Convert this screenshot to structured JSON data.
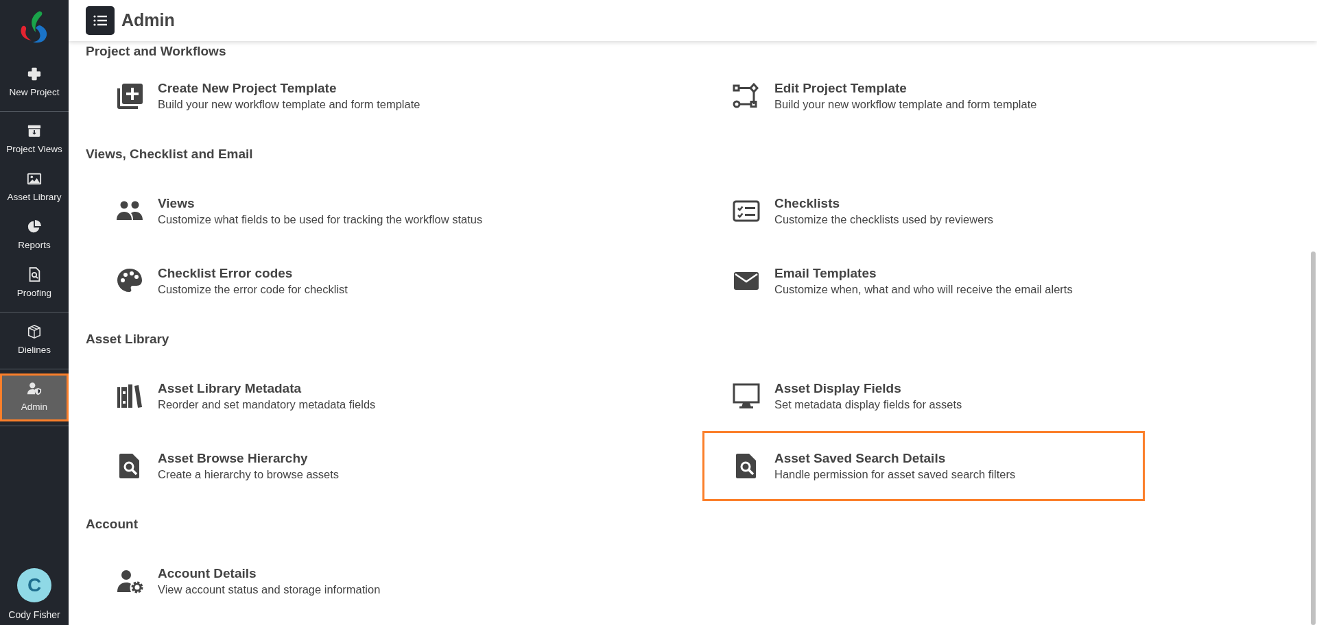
{
  "header": {
    "title": "Admin"
  },
  "sidebar": {
    "groups": [
      [
        {
          "label": "New Project",
          "selected": false
        }
      ],
      [
        {
          "label": "Project Views",
          "selected": false
        },
        {
          "label": "Asset Library",
          "selected": false
        },
        {
          "label": "Reports",
          "selected": false
        },
        {
          "label": "Proofing",
          "selected": false
        }
      ],
      [
        {
          "label": "Dielines",
          "selected": false
        }
      ],
      [
        {
          "label": "Admin",
          "selected": true
        }
      ]
    ],
    "user": {
      "initial": "C",
      "name": "Cody Fisher"
    }
  },
  "sections": [
    {
      "title": "Project and Workflows",
      "items": [
        {
          "title": "Create New Project Template",
          "description": "Build your new workflow template and form template",
          "highlighted": false
        },
        {
          "title": "Edit Project Template",
          "description": "Build your new workflow template and form template",
          "highlighted": false
        }
      ]
    },
    {
      "title": "Views, Checklist and Email",
      "items": [
        {
          "title": "Views",
          "description": "Customize what fields to be used for tracking the workflow status",
          "highlighted": false
        },
        {
          "title": "Checklists",
          "description": "Customize the checklists used by reviewers",
          "highlighted": false
        },
        {
          "title": "Checklist Error codes",
          "description": "Customize the error code for checklist",
          "highlighted": false
        },
        {
          "title": "Email Templates",
          "description": "Customize when, what and who will receive the email alerts",
          "highlighted": false
        }
      ]
    },
    {
      "title": "Asset Library",
      "items": [
        {
          "title": "Asset Library Metadata",
          "description": "Reorder and set mandatory metadata fields",
          "highlighted": false
        },
        {
          "title": "Asset Display Fields",
          "description": "Set metadata display fields for assets",
          "highlighted": false
        },
        {
          "title": "Asset Browse Hierarchy",
          "description": "Create a hierarchy to browse assets",
          "highlighted": false
        },
        {
          "title": "Asset Saved Search Details",
          "description": "Handle permission for asset saved search filters",
          "highlighted": true
        }
      ]
    },
    {
      "title": "Account",
      "items": [
        {
          "title": "Account Details",
          "description": "View account status and storage information",
          "highlighted": false
        }
      ]
    }
  ]
}
